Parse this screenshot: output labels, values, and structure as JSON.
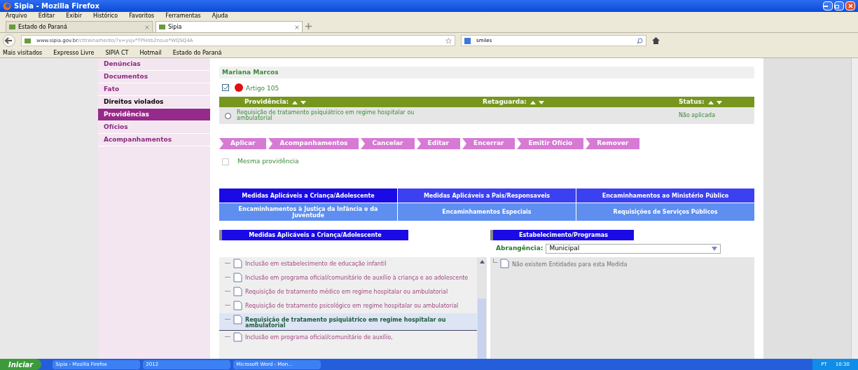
{
  "browser": {
    "title": "Sipia - Mozilla Firefox",
    "menu": [
      "Arquivo",
      "Editar",
      "Exibir",
      "Histórico",
      "Favoritos",
      "Ferramentas",
      "Ajuda"
    ],
    "tabs": [
      {
        "label": "Estado do Paraná",
        "selected": false
      },
      {
        "label": "Sipia",
        "selected": true
      }
    ],
    "url_host": "www.sipia.gov.br",
    "url_path": "/cttreinamento/?x=ysjv*TPHnb2nzuo*WQSQ4A",
    "search": "smiles",
    "bookmarks": [
      "Mais visitados",
      "Expresso Livre",
      "SIPIA CT",
      "Hotmail",
      "Estado do Paraná"
    ]
  },
  "sidebar": {
    "items": [
      {
        "label": "Denúncias",
        "selected": false,
        "visited": false
      },
      {
        "label": "Documentos",
        "selected": false,
        "visited": false
      },
      {
        "label": "Fato",
        "selected": false,
        "visited": false
      },
      {
        "label": "Direitos violados",
        "selected": false,
        "visited": true
      },
      {
        "label": "Providências",
        "selected": true,
        "visited": false
      },
      {
        "label": "Ofícios",
        "selected": false,
        "visited": false
      },
      {
        "label": "Acompanhamentos",
        "selected": false,
        "visited": false
      }
    ]
  },
  "person": "Mariana Marcos",
  "article": {
    "label": "Artigo 105",
    "checked": true
  },
  "table": {
    "columns": [
      "Providência:",
      "Retaguarda:",
      "Status:"
    ],
    "rows": [
      {
        "selected": false,
        "providencia": "Requisição de tratamento psiquiátrico em regime hospitalar ou ambulatorial",
        "status": "Não aplicada"
      }
    ]
  },
  "actions": [
    "Aplicar",
    "Acompanhamentos",
    "Cancelar",
    "Editar",
    "Encerrar",
    "Emitir Ofício",
    "Remover"
  ],
  "same": {
    "label": "Mesma providência",
    "checked": false
  },
  "measure_tabs": [
    [
      {
        "label": "Medidas Aplicáveis a Criança/Adolescente",
        "selected": true
      },
      {
        "label": "Medidas Aplicáveis a Pais/Responsaveis",
        "selected": false
      },
      {
        "label": "Encaminhamentos ao Ministério Público",
        "selected": false
      }
    ],
    [
      {
        "label": "Encaminhamentos à Justiça da Infância e da Juventude",
        "selected": false
      },
      {
        "label": "Encaminhamentos Especiais",
        "selected": false
      },
      {
        "label": "Requisições de Serviços Públicos",
        "selected": false
      }
    ]
  ],
  "left_panel": {
    "title": "Medidas Aplicáveis a Criança/Adolescente",
    "items": [
      {
        "label": "Inclusão em estabelecimento de educação infantil",
        "selected": false
      },
      {
        "label": "Inclusão em programa oficial/comunitário de auxílio à criança e ao adolescente",
        "selected": false
      },
      {
        "label": "Requisição de tratamento médico em regime hospitalar ou ambulatorial",
        "selected": false
      },
      {
        "label": "Requisição de tratamento psicológico em regime hospitalar ou ambulatorial",
        "selected": false
      },
      {
        "label": "Requisição de tratamento psiquiátrico em regime hospitalar ou ambulatorial",
        "selected": true
      },
      {
        "label": "Inclusão em programa oficial/comunitário de auxílio,",
        "selected": false
      }
    ]
  },
  "right_panel": {
    "title": "Estabelecimento/Programas",
    "field_label": "Abrangência:",
    "field_value": "Municipal",
    "empty": "Não existem Entidades para esta Medida"
  },
  "taskbar": {
    "start": "Iniciar",
    "items": [
      "Sipia - Mozilla Firefox",
      "2012",
      "Microsoft Word - Mon..."
    ],
    "lang": "PT",
    "clock": "10:30"
  }
}
